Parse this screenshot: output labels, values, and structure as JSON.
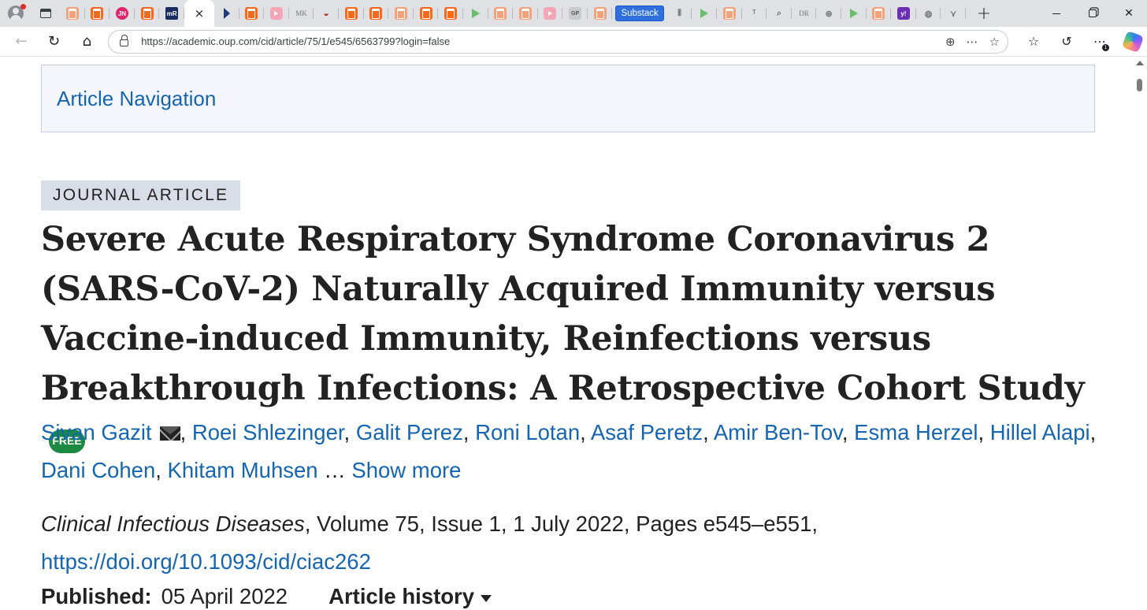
{
  "browser": {
    "active_tab_close_label": "×",
    "tab_favicons": [
      {
        "icon": "substack-icon",
        "style": "orange-faded",
        "text": ""
      },
      {
        "icon": "substack-icon",
        "style": "orange",
        "text": ""
      },
      {
        "icon": "jn-icon",
        "style": "pink",
        "text": "JN"
      },
      {
        "icon": "substack-icon",
        "style": "orange",
        "text": ""
      },
      {
        "icon": "mr-icon",
        "style": "mr",
        "text": "mR"
      }
    ],
    "tab_favicons_after": [
      {
        "icon": "bookmark-arrow-icon",
        "style": "dark",
        "text": ""
      },
      {
        "icon": "substack-icon",
        "style": "orange",
        "text": ""
      },
      {
        "icon": "youtube-icon",
        "style": "yt",
        "text": ""
      },
      {
        "icon": "mk-icon",
        "style": "mk",
        "text": "MK"
      },
      {
        "icon": "fish-icon",
        "style": "fish",
        "text": "◒"
      },
      {
        "icon": "substack-icon",
        "style": "orange",
        "text": ""
      },
      {
        "icon": "substack-icon",
        "style": "orange",
        "text": ""
      },
      {
        "icon": "substack-icon",
        "style": "orange-faded",
        "text": ""
      },
      {
        "icon": "substack-icon",
        "style": "orange",
        "text": ""
      },
      {
        "icon": "substack-icon",
        "style": "orange",
        "text": ""
      },
      {
        "icon": "play-icon",
        "style": "play",
        "text": ""
      },
      {
        "icon": "substack-icon",
        "style": "orange-faded",
        "text": ""
      },
      {
        "icon": "substack-icon",
        "style": "orange-faded",
        "text": ""
      },
      {
        "icon": "youtube-icon",
        "style": "yt",
        "text": ""
      },
      {
        "icon": "gp-icon",
        "style": "grey",
        "text": "GP"
      },
      {
        "icon": "substack-icon",
        "style": "orange-faded",
        "text": ""
      }
    ],
    "substack_tab_label": "Substack",
    "tab_favicons_tail": [
      {
        "icon": "ioe-icon",
        "style": "line",
        "text": "⦀"
      },
      {
        "icon": "play-icon",
        "style": "play",
        "text": ""
      },
      {
        "icon": "substack-icon",
        "style": "orange-faded",
        "text": ""
      },
      {
        "icon": "t-icon",
        "style": "line",
        "text": "ᵀ"
      },
      {
        "icon": "search-icon",
        "style": "line",
        "text": "⌕"
      },
      {
        "icon": "dr-icon",
        "style": "mk",
        "text": "DR"
      },
      {
        "icon": "owl-icon",
        "style": "line",
        "text": "⊛"
      },
      {
        "icon": "play-icon",
        "style": "play",
        "text": ""
      },
      {
        "icon": "b-icon",
        "style": "orange-faded",
        "text": ""
      },
      {
        "icon": "yahoo-icon",
        "style": "purple",
        "text": "y!"
      },
      {
        "icon": "globe-icon",
        "style": "line",
        "text": "◍"
      },
      {
        "icon": "bird-icon",
        "style": "line",
        "text": "⋎"
      }
    ],
    "new_tab_label": "+",
    "url": "https://academic.oup.com/cid/article/75/1/e545/6563799?login=false"
  },
  "page": {
    "article_nav_label": "Article Navigation",
    "article_type": "JOURNAL ARTICLE",
    "title": "Severe Acute Respiratory Syndrome Coronavirus 2 (SARS-CoV-2) Naturally Acquired Immunity versus Vaccine-induced Immunity, Reinfections versus Breakthrough Infections: A Retrospective Cohort Study",
    "free_badge": "FREE",
    "authors": [
      "Sivan Gazit",
      "Roei Shlezinger",
      "Galit Perez",
      "Roni Lotan",
      "Asaf Peretz",
      "Amir Ben-Tov",
      "Esma Herzel",
      "Hillel Alapi",
      "Dani Cohen",
      "Khitam Muhsen"
    ],
    "author_sep": ", ",
    "ellipsis": " … ",
    "show_more": "Show more",
    "journal": "Clinical Infectious Diseases",
    "citation_rest": ", Volume 75, Issue 1, 1 July 2022, Pages e545–e551,",
    "doi": "https://doi.org/10.1093/cid/ciac262",
    "published_label": "Published:",
    "published_date": "05 April 2022",
    "article_history": "Article history"
  }
}
